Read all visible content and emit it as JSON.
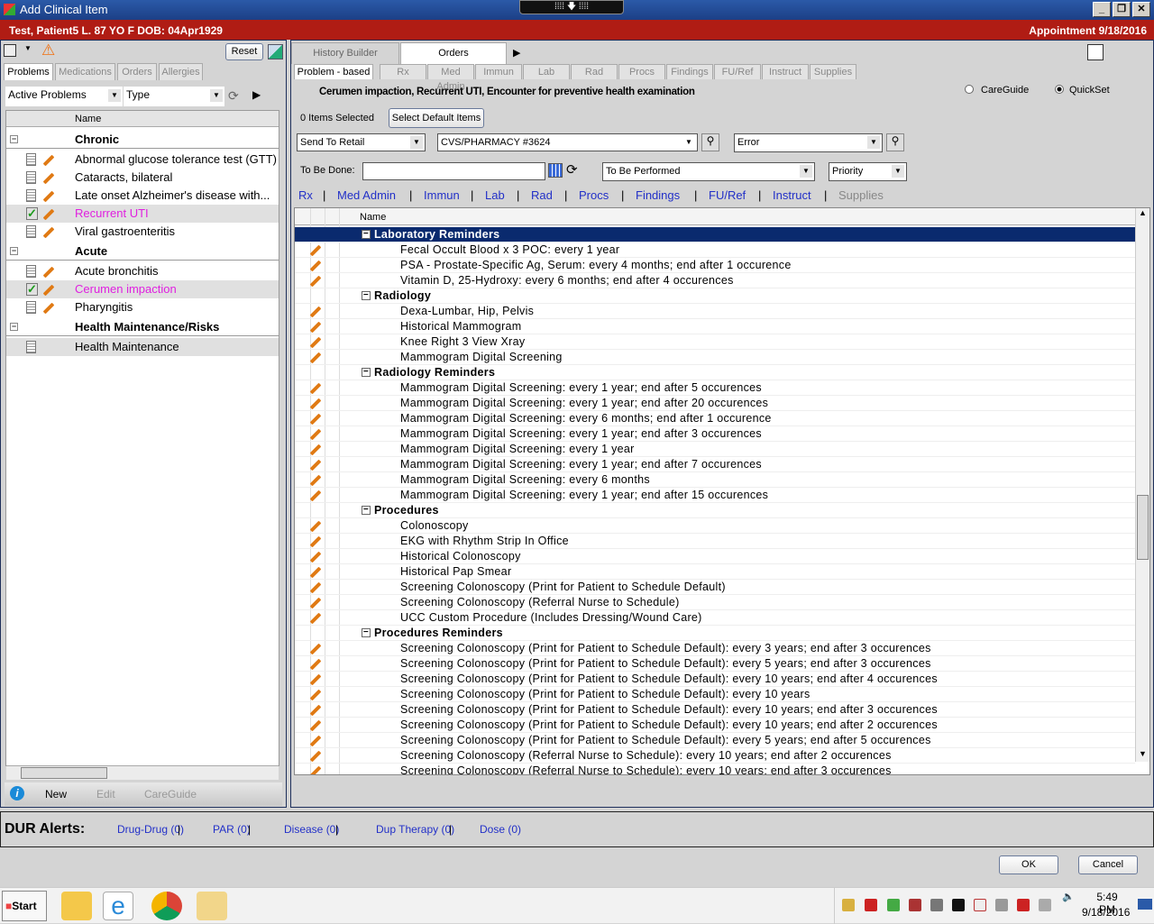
{
  "window": {
    "title": "Add Clinical Item"
  },
  "patient": {
    "banner": "Test, Patient5 L.  87 YO  F DOB: 04Apr1929",
    "appointment": "Appointment  9/18/2016"
  },
  "left": {
    "reset": "Reset",
    "tabs": [
      "Problems",
      "Medications",
      "Orders",
      "Allergies"
    ],
    "filter": "Active Problems",
    "type": "Type",
    "col_name": "Name",
    "rows": [
      {
        "kind": "group",
        "label": "Chronic"
      },
      {
        "kind": "item",
        "label": "Abnormal glucose tolerance test (GTT)"
      },
      {
        "kind": "item",
        "label": "Cataracts, bilateral"
      },
      {
        "kind": "item",
        "label": "Late onset Alzheimer's disease with..."
      },
      {
        "kind": "item",
        "label": "Recurrent UTI",
        "checked": true,
        "color": "#e020e0"
      },
      {
        "kind": "item",
        "label": "Viral gastroenteritis"
      },
      {
        "kind": "group",
        "label": "Acute"
      },
      {
        "kind": "item",
        "label": "Acute bronchitis"
      },
      {
        "kind": "item",
        "label": "Cerumen impaction",
        "checked": true,
        "color": "#e020e0"
      },
      {
        "kind": "item",
        "label": "Pharyngitis"
      },
      {
        "kind": "group",
        "label": "Health Maintenance/Risks"
      },
      {
        "kind": "item",
        "label": "Health Maintenance",
        "nopencil": true
      }
    ],
    "footer": {
      "new": "New",
      "edit": "Edit",
      "careguide": "CareGuide"
    }
  },
  "right": {
    "top_tabs": [
      "History Builder",
      "Orders"
    ],
    "sub_tabs": [
      "Problem - based",
      "Rx",
      "Med Admin",
      "Immun",
      "Lab",
      "Rad",
      "Procs",
      "Findings",
      "FU/Ref",
      "Instruct",
      "Supplies"
    ],
    "problems": "Cerumen impaction, Recurrent UTI, Encounter for preventive health examination",
    "radio_careguide": "CareGuide",
    "radio_quickset": "QuickSet",
    "selected_radio": "QuickSet",
    "items_selected": "0 Items Selected",
    "select_default": "Select Default Items",
    "send_to": "Send To Retail",
    "pharmacy": "CVS/PHARMACY #3624",
    "error": "Error",
    "to_be_done_label": "To Be Done:",
    "to_be_done_value": "",
    "to_be_performed": "To Be Performed",
    "priority": "Priority",
    "links": [
      "Rx",
      "Med Admin",
      "Immun",
      "Lab",
      "Rad",
      "Procs",
      "Findings",
      "FU/Ref",
      "Instruct",
      "Supplies"
    ],
    "col_name": "Name",
    "rows": [
      {
        "kind": "group",
        "label": "Laboratory Reminders",
        "highlight": true
      },
      {
        "kind": "item",
        "label": "Fecal Occult Blood x 3 POC: every 1 year"
      },
      {
        "kind": "item",
        "label": "PSA - Prostate-Specific Ag, Serum: every 4 months; end after 1 occurence"
      },
      {
        "kind": "item",
        "label": "Vitamin D, 25-Hydroxy: every 6 months; end after 4 occurences"
      },
      {
        "kind": "group",
        "label": "Radiology"
      },
      {
        "kind": "item",
        "label": "Dexa-Lumbar, Hip, Pelvis"
      },
      {
        "kind": "item",
        "label": "Historical Mammogram"
      },
      {
        "kind": "item",
        "label": "Knee Right 3 View Xray"
      },
      {
        "kind": "item",
        "label": "Mammogram Digital Screening"
      },
      {
        "kind": "group",
        "label": "Radiology Reminders"
      },
      {
        "kind": "item",
        "label": "Mammogram Digital Screening: every 1 year; end after 5 occurences"
      },
      {
        "kind": "item",
        "label": "Mammogram Digital Screening: every 1 year; end after 20 occurences"
      },
      {
        "kind": "item",
        "label": "Mammogram Digital Screening: every 6 months; end after 1 occurence"
      },
      {
        "kind": "item",
        "label": "Mammogram Digital Screening: every 1 year; end after 3 occurences"
      },
      {
        "kind": "item",
        "label": "Mammogram Digital Screening: every 1 year"
      },
      {
        "kind": "item",
        "label": "Mammogram Digital Screening: every 1 year; end after 7 occurences"
      },
      {
        "kind": "item",
        "label": "Mammogram Digital Screening: every 6 months"
      },
      {
        "kind": "item",
        "label": "Mammogram Digital Screening: every 1 year; end after 15 occurences"
      },
      {
        "kind": "group",
        "label": "Procedures"
      },
      {
        "kind": "item",
        "label": "Colonoscopy"
      },
      {
        "kind": "item",
        "label": "EKG with Rhythm Strip In Office"
      },
      {
        "kind": "item",
        "label": "Historical Colonoscopy"
      },
      {
        "kind": "item",
        "label": "Historical Pap Smear"
      },
      {
        "kind": "item",
        "label": "Screening Colonoscopy (Print for Patient to Schedule Default)"
      },
      {
        "kind": "item",
        "label": "Screening Colonoscopy (Referral Nurse to Schedule)"
      },
      {
        "kind": "item",
        "label": "UCC Custom Procedure (Includes Dressing/Wound Care)"
      },
      {
        "kind": "group",
        "label": "Procedures Reminders"
      },
      {
        "kind": "item",
        "label": "Screening Colonoscopy (Print for Patient to Schedule Default): every 3 years; end after 3 occurences"
      },
      {
        "kind": "item",
        "label": "Screening Colonoscopy (Print for Patient to Schedule Default): every 5 years; end after 3 occurences"
      },
      {
        "kind": "item",
        "label": "Screening Colonoscopy (Print for Patient to Schedule Default): every 10 years; end after 4 occurences"
      },
      {
        "kind": "item",
        "label": "Screening Colonoscopy (Print for Patient to Schedule Default): every 10 years"
      },
      {
        "kind": "item",
        "label": "Screening Colonoscopy (Print for Patient to Schedule Default): every 10 years; end after 3 occurences"
      },
      {
        "kind": "item",
        "label": "Screening Colonoscopy (Print for Patient to Schedule Default): every 10 years; end after 2 occurences"
      },
      {
        "kind": "item",
        "label": "Screening Colonoscopy (Print for Patient to Schedule Default): every 5 years; end after 5 occurences"
      },
      {
        "kind": "item",
        "label": "Screening Colonoscopy (Referral Nurse to Schedule): every 10 years; end after 2 occurences"
      },
      {
        "kind": "item",
        "label": "Screening Colonoscopy (Referral Nurse to Schedule): every 10 years; end after 3 occurences"
      }
    ]
  },
  "dur": {
    "label": "DUR Alerts:",
    "items": [
      "Drug-Drug (0)",
      "PAR (0)",
      "Disease (0)",
      "Dup Therapy (0)",
      "Dose (0)"
    ]
  },
  "dialog": {
    "ok": "OK",
    "cancel": "Cancel"
  },
  "taskbar": {
    "start": "Start",
    "time": "5:49 PM",
    "date": "9/18/2016"
  },
  "colors": {
    "title": "#1c3f86",
    "banner": "#b01c14",
    "link": "#2230c8",
    "selected_problem": "#e020e0",
    "highlight_row": "#0a2a6e"
  }
}
